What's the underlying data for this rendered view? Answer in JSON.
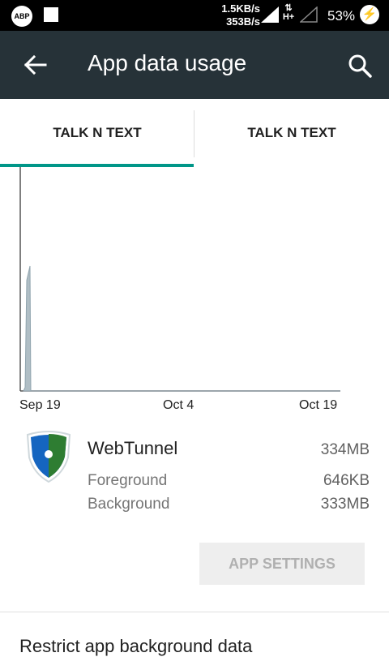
{
  "status_bar": {
    "abp_label": "ABP",
    "speed_up": "1.5KB/s",
    "speed_down": "353B/s",
    "network_type": "H+",
    "battery_percent": "53%",
    "icons": [
      "adblock-icon",
      "notification-square-icon",
      "data-arrows-icon",
      "signal-icon",
      "signal-empty-icon",
      "battery-charging-icon"
    ]
  },
  "app_bar": {
    "title": "App data usage",
    "back_icon": "back-arrow-icon",
    "search_icon": "search-icon",
    "color": "#263238"
  },
  "tabs": [
    {
      "label": "TALK N TEXT",
      "selected": true
    },
    {
      "label": "TALK N TEXT",
      "selected": false
    }
  ],
  "accent_color": "#009688",
  "chart_data": {
    "type": "area",
    "x_tick_labels": [
      "Sep 19",
      "Oct 4",
      "Oct 19"
    ],
    "series": [
      {
        "values_relative": [
          0,
          0.02,
          0.62,
          0.7,
          0,
          0
        ]
      }
    ],
    "grid": false
  },
  "app_usage": {
    "name": "WebTunnel",
    "total": "334MB",
    "foreground_label": "Foreground",
    "foreground_value": "646KB",
    "background_label": "Background",
    "background_value": "333MB"
  },
  "app_settings_button": "APP SETTINGS",
  "restrict_label": "Restrict app background data"
}
